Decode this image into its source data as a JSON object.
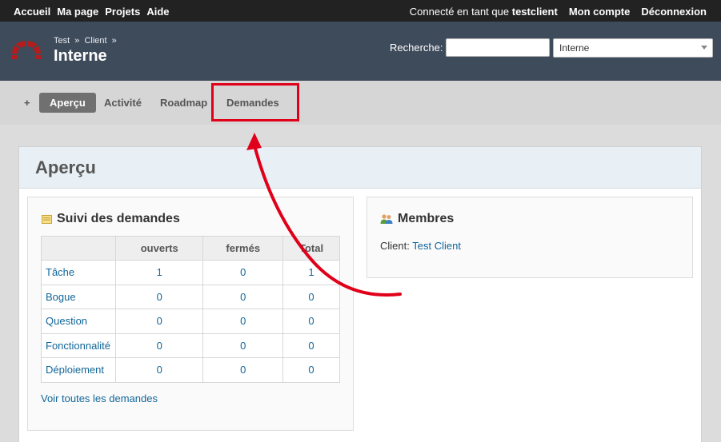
{
  "top_menu": {
    "left_items": [
      "Accueil",
      "Ma page",
      "Projets",
      "Aide"
    ],
    "logged_as_prefix": "Connecté en tant que",
    "logged_as_user": "testclient",
    "account_label": "Mon compte",
    "logout_label": "Déconnexion"
  },
  "header": {
    "breadcrumb": [
      "Test",
      "Client"
    ],
    "breadcrumb_sep": "»",
    "project_title": "Interne",
    "search_label": "Recherche:",
    "search_value": "",
    "project_select_value": "Interne"
  },
  "main_menu": {
    "items": [
      {
        "label": "+"
      },
      {
        "label": "Aperçu",
        "selected": true
      },
      {
        "label": "Activité"
      },
      {
        "label": "Roadmap"
      },
      {
        "label": "Demandes"
      }
    ]
  },
  "content": {
    "title": "Aperçu",
    "issues": {
      "title": "Suivi des demandes",
      "columns": [
        "",
        "ouverts",
        "fermés",
        "Total"
      ],
      "rows": [
        {
          "tracker": "Tâche",
          "open": "1",
          "closed": "0",
          "total": "1"
        },
        {
          "tracker": "Bogue",
          "open": "0",
          "closed": "0",
          "total": "0"
        },
        {
          "tracker": "Question",
          "open": "0",
          "closed": "0",
          "total": "0"
        },
        {
          "tracker": "Fonctionnalité",
          "open": "0",
          "closed": "0",
          "total": "0"
        },
        {
          "tracker": "Déploiement",
          "open": "0",
          "closed": "0",
          "total": "0"
        }
      ],
      "view_all": "Voir toutes les demandes"
    },
    "members": {
      "title": "Membres",
      "role": "Client:",
      "member": "Test Client"
    }
  },
  "colors": {
    "annotation": "#e0001a",
    "link": "#116699",
    "header_bg": "#3e4b5a"
  }
}
